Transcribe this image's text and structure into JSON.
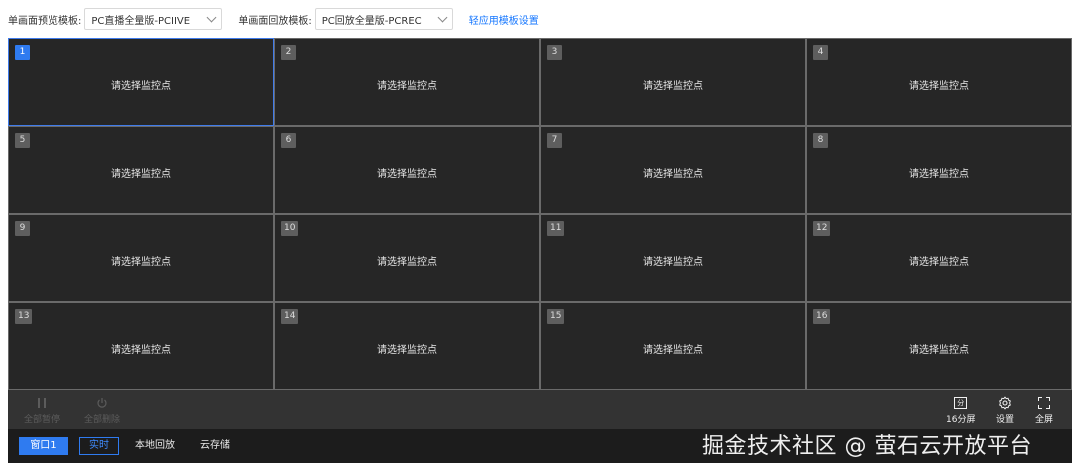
{
  "toolbar": {
    "preview_label": "单画面预览模板:",
    "preview_value": "PC直播全量版-PCIIVE",
    "playback_label": "单画面回放模板:",
    "playback_value": "PC回放全量版-PCREC",
    "template_link": "轻应用模板设置"
  },
  "grid": {
    "placeholder": "请选择监控点",
    "active_index": 1,
    "cells": [
      "1",
      "2",
      "3",
      "4",
      "5",
      "6",
      "7",
      "8",
      "9",
      "10",
      "11",
      "12",
      "13",
      "14",
      "15",
      "16"
    ]
  },
  "controls": {
    "pause_all": "全部暂停",
    "close_all": "全部删除",
    "split": "16分屏",
    "split_icon_text": "分",
    "settings": "设置",
    "fullscreen": "全屏"
  },
  "tabs": {
    "window": "窗口1",
    "live": "实时",
    "local": "本地回放",
    "cloud": "云存储"
  },
  "watermark": "掘金技术社区 @ 萤石云开放平台",
  "colors": {
    "accent": "#2f7bf0",
    "link": "#1677ff",
    "panel": "#262626",
    "control_bar": "#333333",
    "tab_bar": "#1c1c1c"
  }
}
